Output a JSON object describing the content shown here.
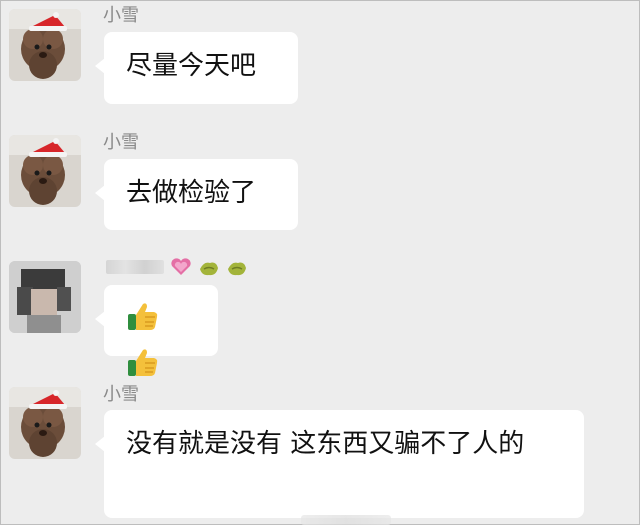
{
  "messages": [
    {
      "sender": "小雪",
      "text": "尽量今天吧",
      "avatar": "dog-avatar"
    },
    {
      "sender": "小雪",
      "text": "去做检验了",
      "avatar": "dog-avatar"
    },
    {
      "sender": "",
      "sender_emojis": [
        "heart-emoji",
        "leaf-emoji",
        "leaf-emoji"
      ],
      "text": "",
      "emojis": [
        "thumbs-up-emoji",
        "thumbs-up-emoji"
      ],
      "avatar": "blurred-person-avatar"
    },
    {
      "sender": "小雪",
      "text": "没有就是没有 这东西又骗不了人的",
      "avatar": "dog-avatar"
    }
  ],
  "colors": {
    "background": "#ededed",
    "bubble": "#ffffff",
    "sender_text": "#8a8a8a",
    "message_text": "#111111"
  }
}
